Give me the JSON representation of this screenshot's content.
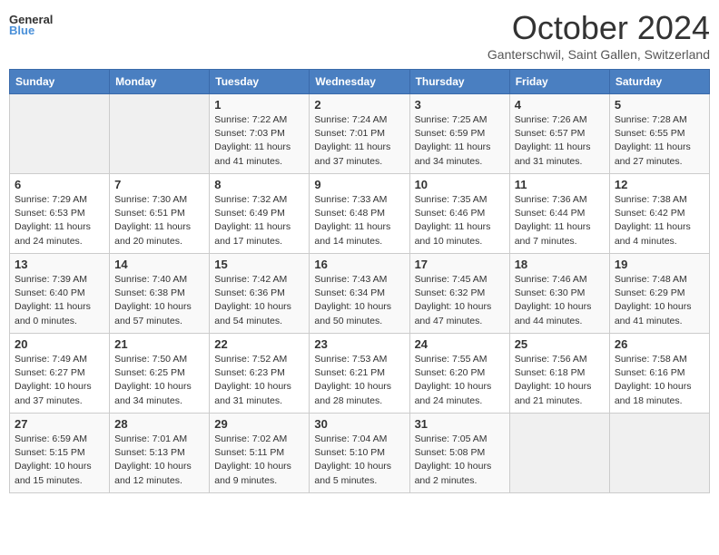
{
  "header": {
    "logo_line1": "General",
    "logo_line2": "Blue",
    "month_title": "October 2024",
    "location": "Ganterschwil, Saint Gallen, Switzerland"
  },
  "days_of_week": [
    "Sunday",
    "Monday",
    "Tuesday",
    "Wednesday",
    "Thursday",
    "Friday",
    "Saturday"
  ],
  "weeks": [
    [
      null,
      null,
      {
        "day": "1",
        "sunrise": "Sunrise: 7:22 AM",
        "sunset": "Sunset: 7:03 PM",
        "daylight": "Daylight: 11 hours and 41 minutes."
      },
      {
        "day": "2",
        "sunrise": "Sunrise: 7:24 AM",
        "sunset": "Sunset: 7:01 PM",
        "daylight": "Daylight: 11 hours and 37 minutes."
      },
      {
        "day": "3",
        "sunrise": "Sunrise: 7:25 AM",
        "sunset": "Sunset: 6:59 PM",
        "daylight": "Daylight: 11 hours and 34 minutes."
      },
      {
        "day": "4",
        "sunrise": "Sunrise: 7:26 AM",
        "sunset": "Sunset: 6:57 PM",
        "daylight": "Daylight: 11 hours and 31 minutes."
      },
      {
        "day": "5",
        "sunrise": "Sunrise: 7:28 AM",
        "sunset": "Sunset: 6:55 PM",
        "daylight": "Daylight: 11 hours and 27 minutes."
      }
    ],
    [
      {
        "day": "6",
        "sunrise": "Sunrise: 7:29 AM",
        "sunset": "Sunset: 6:53 PM",
        "daylight": "Daylight: 11 hours and 24 minutes."
      },
      {
        "day": "7",
        "sunrise": "Sunrise: 7:30 AM",
        "sunset": "Sunset: 6:51 PM",
        "daylight": "Daylight: 11 hours and 20 minutes."
      },
      {
        "day": "8",
        "sunrise": "Sunrise: 7:32 AM",
        "sunset": "Sunset: 6:49 PM",
        "daylight": "Daylight: 11 hours and 17 minutes."
      },
      {
        "day": "9",
        "sunrise": "Sunrise: 7:33 AM",
        "sunset": "Sunset: 6:48 PM",
        "daylight": "Daylight: 11 hours and 14 minutes."
      },
      {
        "day": "10",
        "sunrise": "Sunrise: 7:35 AM",
        "sunset": "Sunset: 6:46 PM",
        "daylight": "Daylight: 11 hours and 10 minutes."
      },
      {
        "day": "11",
        "sunrise": "Sunrise: 7:36 AM",
        "sunset": "Sunset: 6:44 PM",
        "daylight": "Daylight: 11 hours and 7 minutes."
      },
      {
        "day": "12",
        "sunrise": "Sunrise: 7:38 AM",
        "sunset": "Sunset: 6:42 PM",
        "daylight": "Daylight: 11 hours and 4 minutes."
      }
    ],
    [
      {
        "day": "13",
        "sunrise": "Sunrise: 7:39 AM",
        "sunset": "Sunset: 6:40 PM",
        "daylight": "Daylight: 11 hours and 0 minutes."
      },
      {
        "day": "14",
        "sunrise": "Sunrise: 7:40 AM",
        "sunset": "Sunset: 6:38 PM",
        "daylight": "Daylight: 10 hours and 57 minutes."
      },
      {
        "day": "15",
        "sunrise": "Sunrise: 7:42 AM",
        "sunset": "Sunset: 6:36 PM",
        "daylight": "Daylight: 10 hours and 54 minutes."
      },
      {
        "day": "16",
        "sunrise": "Sunrise: 7:43 AM",
        "sunset": "Sunset: 6:34 PM",
        "daylight": "Daylight: 10 hours and 50 minutes."
      },
      {
        "day": "17",
        "sunrise": "Sunrise: 7:45 AM",
        "sunset": "Sunset: 6:32 PM",
        "daylight": "Daylight: 10 hours and 47 minutes."
      },
      {
        "day": "18",
        "sunrise": "Sunrise: 7:46 AM",
        "sunset": "Sunset: 6:30 PM",
        "daylight": "Daylight: 10 hours and 44 minutes."
      },
      {
        "day": "19",
        "sunrise": "Sunrise: 7:48 AM",
        "sunset": "Sunset: 6:29 PM",
        "daylight": "Daylight: 10 hours and 41 minutes."
      }
    ],
    [
      {
        "day": "20",
        "sunrise": "Sunrise: 7:49 AM",
        "sunset": "Sunset: 6:27 PM",
        "daylight": "Daylight: 10 hours and 37 minutes."
      },
      {
        "day": "21",
        "sunrise": "Sunrise: 7:50 AM",
        "sunset": "Sunset: 6:25 PM",
        "daylight": "Daylight: 10 hours and 34 minutes."
      },
      {
        "day": "22",
        "sunrise": "Sunrise: 7:52 AM",
        "sunset": "Sunset: 6:23 PM",
        "daylight": "Daylight: 10 hours and 31 minutes."
      },
      {
        "day": "23",
        "sunrise": "Sunrise: 7:53 AM",
        "sunset": "Sunset: 6:21 PM",
        "daylight": "Daylight: 10 hours and 28 minutes."
      },
      {
        "day": "24",
        "sunrise": "Sunrise: 7:55 AM",
        "sunset": "Sunset: 6:20 PM",
        "daylight": "Daylight: 10 hours and 24 minutes."
      },
      {
        "day": "25",
        "sunrise": "Sunrise: 7:56 AM",
        "sunset": "Sunset: 6:18 PM",
        "daylight": "Daylight: 10 hours and 21 minutes."
      },
      {
        "day": "26",
        "sunrise": "Sunrise: 7:58 AM",
        "sunset": "Sunset: 6:16 PM",
        "daylight": "Daylight: 10 hours and 18 minutes."
      }
    ],
    [
      {
        "day": "27",
        "sunrise": "Sunrise: 6:59 AM",
        "sunset": "Sunset: 5:15 PM",
        "daylight": "Daylight: 10 hours and 15 minutes."
      },
      {
        "day": "28",
        "sunrise": "Sunrise: 7:01 AM",
        "sunset": "Sunset: 5:13 PM",
        "daylight": "Daylight: 10 hours and 12 minutes."
      },
      {
        "day": "29",
        "sunrise": "Sunrise: 7:02 AM",
        "sunset": "Sunset: 5:11 PM",
        "daylight": "Daylight: 10 hours and 9 minutes."
      },
      {
        "day": "30",
        "sunrise": "Sunrise: 7:04 AM",
        "sunset": "Sunset: 5:10 PM",
        "daylight": "Daylight: 10 hours and 5 minutes."
      },
      {
        "day": "31",
        "sunrise": "Sunrise: 7:05 AM",
        "sunset": "Sunset: 5:08 PM",
        "daylight": "Daylight: 10 hours and 2 minutes."
      },
      null,
      null
    ]
  ]
}
